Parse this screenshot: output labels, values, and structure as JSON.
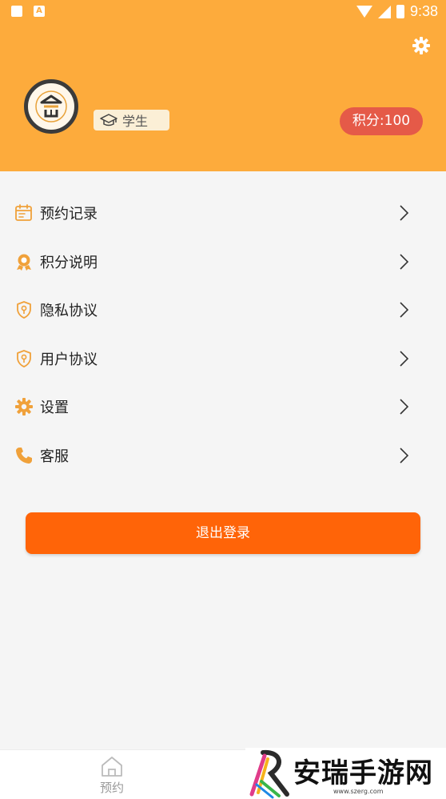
{
  "status_bar": {
    "time": "9:38",
    "notif_icons": [
      "mail-icon",
      "a-app-icon"
    ],
    "right_icons": [
      "wifi-icon",
      "signal-icon",
      "battery-icon"
    ]
  },
  "header": {
    "background": "#fdab3c",
    "settings_icon": "gear-icon",
    "avatar_icon": "logo-icon",
    "role_label": "学生",
    "role_icon": "graduation-cap-icon",
    "points_label": "积分:100"
  },
  "menu": {
    "items": [
      {
        "label": "预约记录",
        "icon": "calendar-icon"
      },
      {
        "label": "积分说明",
        "icon": "award-icon"
      },
      {
        "label": "隐私协议",
        "icon": "shield-icon"
      },
      {
        "label": "用户协议",
        "icon": "shield-icon"
      },
      {
        "label": "设置",
        "icon": "gear-icon"
      },
      {
        "label": "客服",
        "icon": "phone-icon"
      }
    ]
  },
  "logout": {
    "label": "退出登录",
    "color": "#ff6408"
  },
  "tabbar": {
    "home_label": "预约",
    "home_icon": "home-icon"
  },
  "watermark": {
    "text": "安瑞手游网",
    "url": "www.szerg.com"
  }
}
